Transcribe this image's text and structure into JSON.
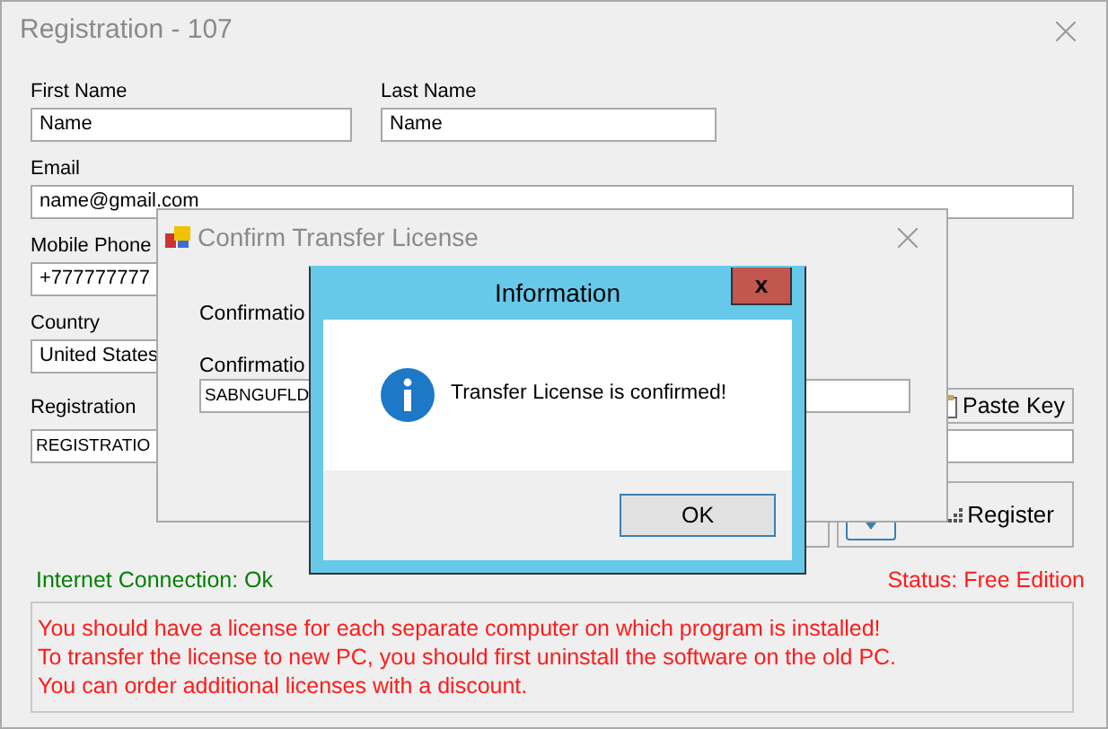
{
  "main_window": {
    "title": "Registration - 107",
    "name_fields": [
      {
        "label": "First Name",
        "value": "Name"
      },
      {
        "label": "Last Name",
        "value": "Name"
      }
    ],
    "fields": [
      {
        "label": "Email",
        "value": "name@gmail.com",
        "kind": "wide"
      },
      {
        "label": "Mobile Phone",
        "value": "+777777777",
        "kind": "short"
      },
      {
        "label": "Country",
        "value": "United States",
        "kind": "short"
      }
    ],
    "registration": {
      "label": "Registration",
      "value": "REGISTRATIO"
    },
    "paste_key_button": "Paste Key",
    "register_button": "Register",
    "internet_status": "Internet Connection: Ok",
    "edition_status": "Status: Free Edition",
    "notice_lines": [
      "You should have a license for each separate computer on which program is installed!",
      "To transfer the license to new PC, you should first uninstall the software on the old PC.",
      "You can order additional licenses with a discount."
    ]
  },
  "confirm_dialog": {
    "title": "Confirm Transfer License",
    "labels": [
      "Confirmatio",
      "Confirmatio"
    ],
    "value": "SABNGUFLD"
  },
  "info_dialog": {
    "title": "Information",
    "close": "x",
    "message": "Transfer License is confirmed!",
    "ok_button": "OK"
  }
}
